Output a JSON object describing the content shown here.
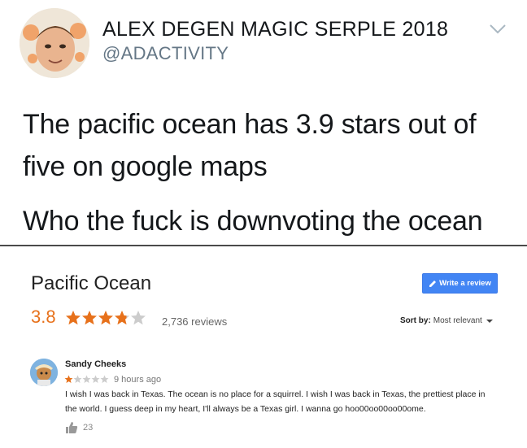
{
  "tweet": {
    "display_name": "ALEX DEGEN MAGIC SERPLE 2018",
    "handle": "@ADACTIVITY",
    "text_line_1": "The pacific ocean has 3.9 stars out of",
    "text_line_2": "five on google maps",
    "text_line_3": "Who the fuck is downvoting the ocean"
  },
  "place": {
    "title": "Pacific Ocean",
    "write_review_label": "Write a review",
    "rating": "3.8",
    "rating_stars": 3.8,
    "review_count": "2,736 reviews",
    "sort_label": "Sort by:",
    "sort_value": "Most relevant"
  },
  "review": {
    "author": "Sandy Cheeks",
    "stars": 1,
    "time": "9 hours ago",
    "text": "I wish I was back in Texas. The ocean is no place for a squirrel. I wish I was back in Texas, the prettiest place in the world. I guess deep in my heart, I'll always be a Texas girl. I wanna go hoo00oo00oo00ome.",
    "likes": "23"
  },
  "colors": {
    "star_filled": "#e7711b",
    "star_empty": "#cccccc",
    "button_blue": "#4285f4",
    "handle_gray": "#657786"
  },
  "icons": {
    "caret": "chevron-down-icon",
    "write": "pencil-icon",
    "thumb": "thumbs-up-icon"
  }
}
